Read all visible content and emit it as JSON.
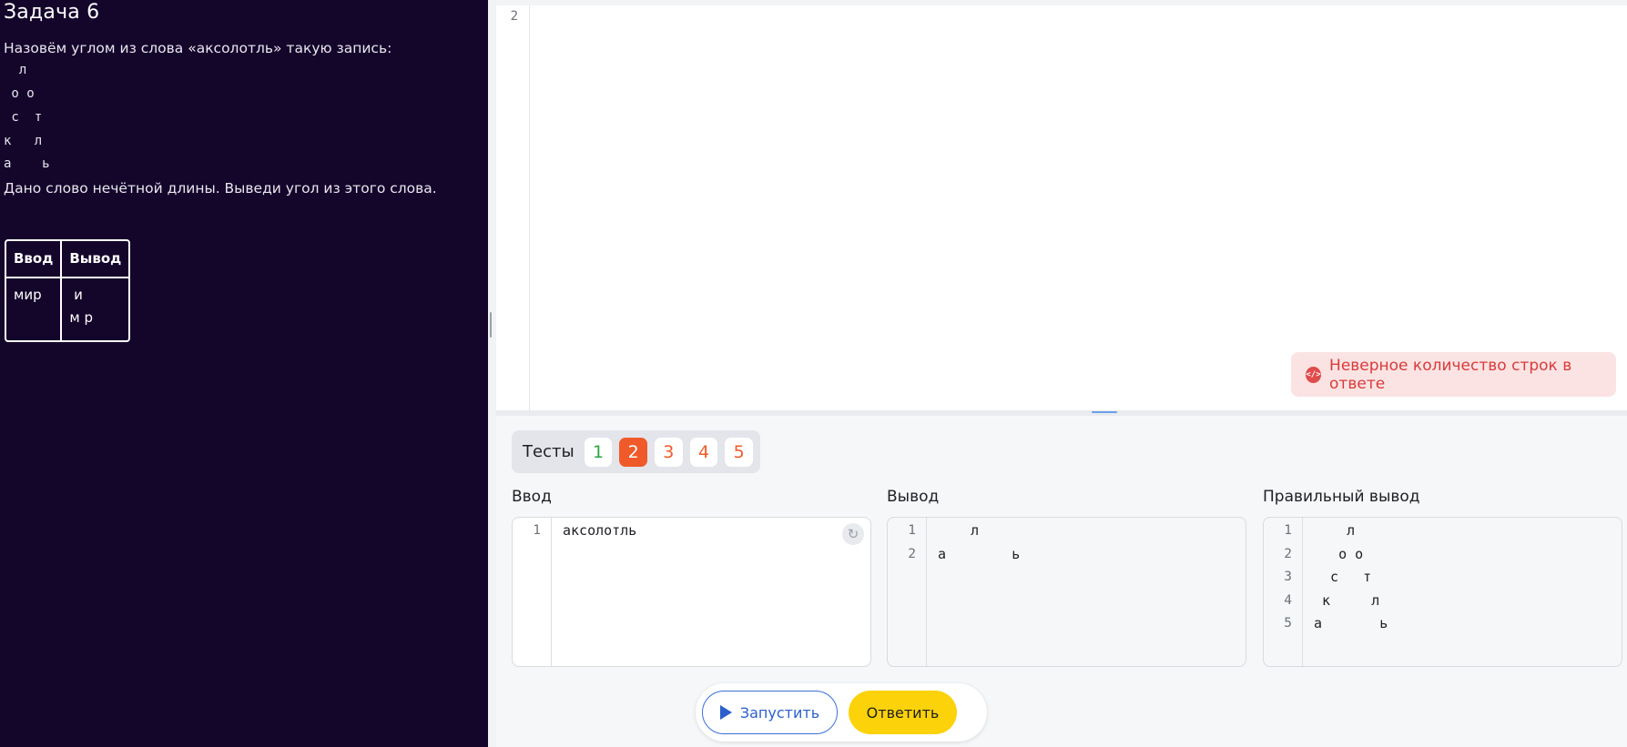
{
  "task": {
    "title": "Задача 6",
    "intro": "Назовём углом из слова «аксолотль» такую запись:",
    "art_lines": [
      "  л",
      " о о",
      " с  т",
      "к   л",
      "а    ь"
    ],
    "outro": "Дано слово нечётной длины. Выведи угол из этого слова.",
    "example": {
      "headers": [
        "Ввод",
        "Вывод"
      ],
      "input": "мир",
      "output": " и\nм р"
    }
  },
  "editor": {
    "visible_line_number": "2",
    "error_message": "Неверное количество строк в ответе"
  },
  "tests": {
    "label": "Тесты",
    "items": [
      {
        "label": "1",
        "status": "pass"
      },
      {
        "label": "2",
        "status": "fail-active"
      },
      {
        "label": "3",
        "status": "fail"
      },
      {
        "label": "4",
        "status": "fail"
      },
      {
        "label": "5",
        "status": "fail"
      }
    ]
  },
  "io": {
    "input_label": "Ввод",
    "output_label": "Вывод",
    "expected_label": "Правильный вывод",
    "input_lines": [
      "аксолотль"
    ],
    "output_lines": [
      "    л",
      "а        ь"
    ],
    "expected_lines": [
      "    л",
      "   о о",
      "  с   т",
      " к     л",
      "а       ь"
    ]
  },
  "actions": {
    "run_label": "Запустить",
    "answer_label": "Ответить"
  },
  "colors": {
    "panel_bg": "#14052b",
    "pass": "#27a644",
    "fail": "#f05a2a",
    "error_bg": "#fbe3e3",
    "error_text": "#d83b3b",
    "answer_yellow": "#fcd20a",
    "run_blue": "#2c5fcc"
  }
}
